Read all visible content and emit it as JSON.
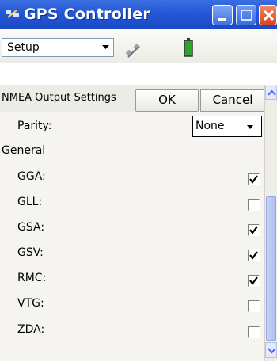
{
  "window": {
    "title": "GPS Controller",
    "controls": {
      "minimize": "minimize-button",
      "maximize": "maximize-button",
      "close": "close-button"
    }
  },
  "toolbar": {
    "menu_label": "Setup",
    "menu_icon": "chevron-down-icon",
    "icons": [
      "satellite-icon",
      "battery-icon"
    ]
  },
  "settings": {
    "header": "NMEA Output Settings",
    "ok_label": "OK",
    "cancel_label": "Cancel",
    "parity": {
      "label": "Parity:",
      "value": "None"
    },
    "section_general": "General",
    "sentences": [
      {
        "label": "GGA:",
        "checked": true
      },
      {
        "label": "GLL:",
        "checked": false
      },
      {
        "label": "GSA:",
        "checked": true
      },
      {
        "label": "GSV:",
        "checked": true
      },
      {
        "label": "RMC:",
        "checked": true
      },
      {
        "label": "VTG:",
        "checked": false
      },
      {
        "label": "ZDA:",
        "checked": false
      }
    ]
  },
  "colors": {
    "title_bar": "#2457d6",
    "close_button": "#d8441f",
    "battery": "#2fa32f"
  }
}
